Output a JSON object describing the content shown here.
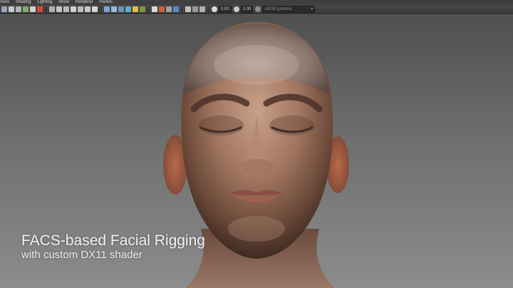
{
  "menu": {
    "items": [
      "View",
      "Shading",
      "Lighting",
      "Show",
      "Renderer",
      "Panels"
    ]
  },
  "toolbar": {
    "exposure_value": "0.00",
    "gamma_value": "1.00",
    "color_space": "sRGB gamma"
  },
  "viewport": {
    "caption_line1": "FACS-based Facial Rigging",
    "caption_line2": "with custom DX11 shader"
  }
}
